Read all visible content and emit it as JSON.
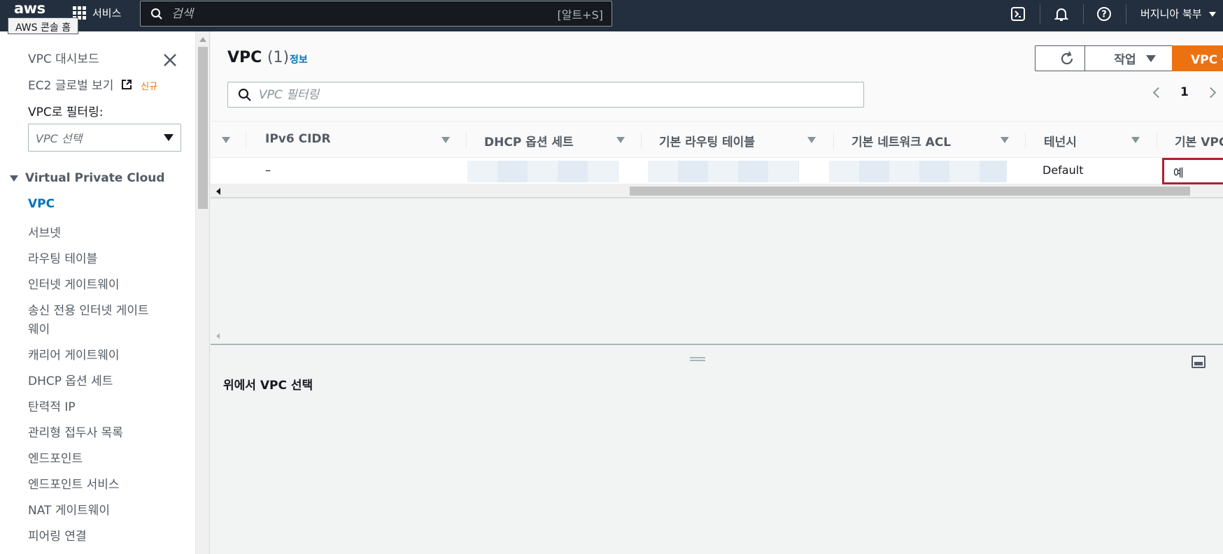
{
  "topnav": {
    "logo": "aws",
    "tooltip": "AWS 콘솔 홈",
    "services_label": "서비스",
    "search_placeholder": "검색",
    "search_shortcut": "[알트+S]",
    "region": "버지니아 북부"
  },
  "sidebar": {
    "dashboard": "VPC 대시보드",
    "ec2_global": "EC2 글로벌 보기",
    "new_tag": "신규",
    "filter_label": "VPC로 필터링:",
    "filter_placeholder": "VPC 선택",
    "section": "Virtual Private Cloud",
    "items": [
      "VPC",
      "서브넷",
      "라우팅 테이블",
      "인터넷 게이트웨이",
      "송신 전용 인터넷 게이트",
      "웨이",
      "캐리어 게이트웨이",
      "DHCP 옵션 세트",
      "탄력적 IP",
      "관리형 접두사 목록",
      "엔드포인트",
      "엔드포인트 서비스",
      "NAT 게이트웨이",
      "피어링 연결"
    ]
  },
  "main": {
    "title": "VPC",
    "count": "(1)",
    "info": "정보",
    "actions_label": "작업",
    "create_label": "VPC 생",
    "filter_placeholder": "VPC 필터링",
    "page": "1"
  },
  "table": {
    "columns": [
      "IPv6 CIDR",
      "DHCP 옵션 세트",
      "기본 라우팅 테이블",
      "기본 네트워크 ACL",
      "테넌시",
      "기본 VPC"
    ],
    "row": {
      "ipv6": "–",
      "tenancy": "Default",
      "default_vpc": "예"
    }
  },
  "split": {
    "title": "위에서 VPC 선택"
  },
  "colors": {
    "nav_bg": "#232f3e",
    "accent_orange": "#ec7211",
    "link_blue": "#0073bb",
    "highlight_red": "#b21f2d"
  }
}
